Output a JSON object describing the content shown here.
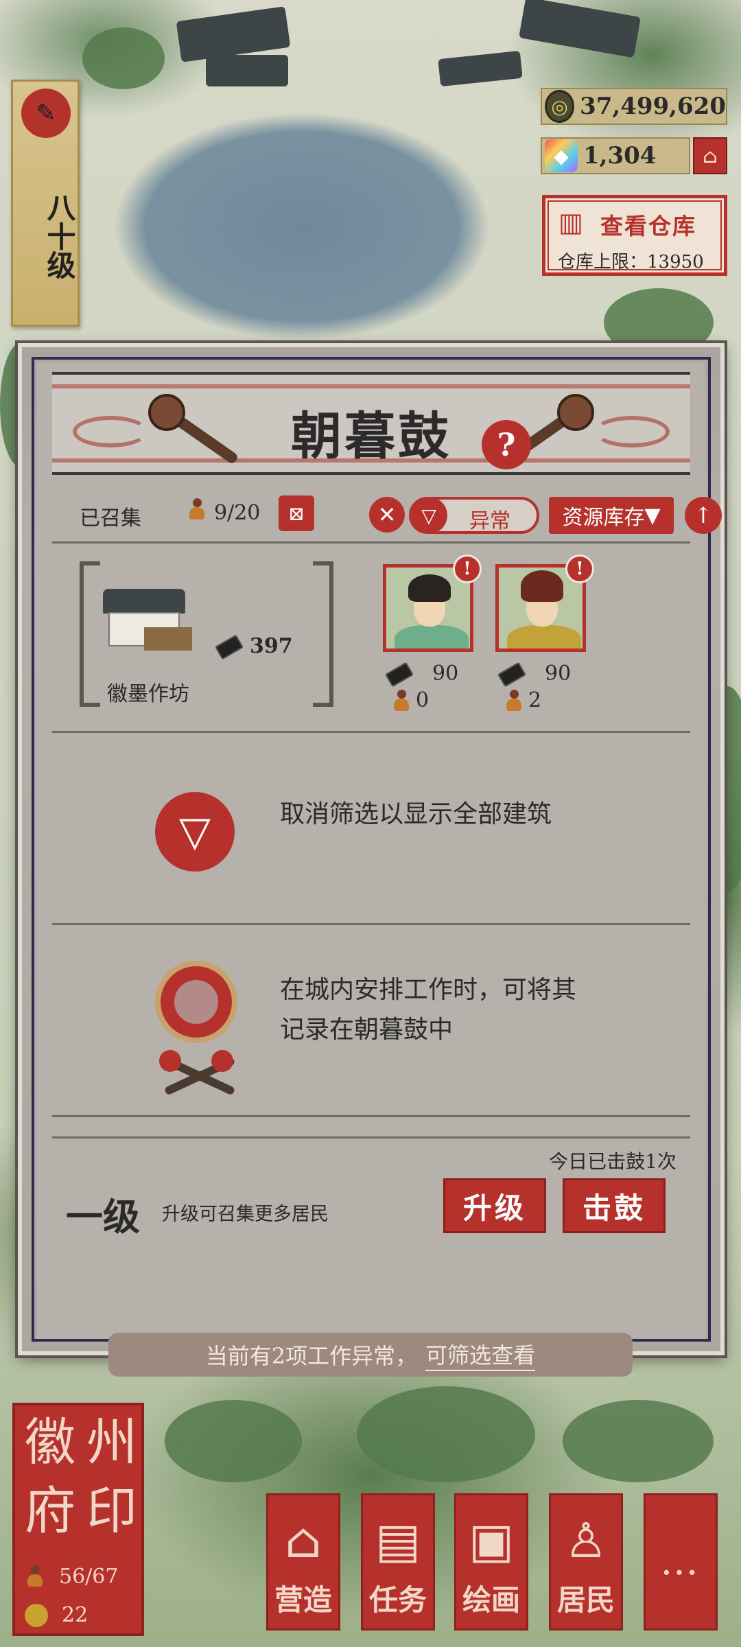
{
  "level_banner": {
    "text": "八十级",
    "icon": "brush-icon"
  },
  "currency": {
    "coins": "37,499,620",
    "gems": "1,304"
  },
  "warehouse": {
    "title": "查看仓库",
    "limit_label": "仓库上限：13950"
  },
  "dialog": {
    "title": "朝暮鼓",
    "help": "?",
    "collected_label": "已召集",
    "collected_count": "9/20",
    "filter_label": "异常",
    "sort_label": "资源库存",
    "building": {
      "name": "徽墨作坊",
      "stock": "397"
    },
    "workers": [
      {
        "ink": "90",
        "residents": "0",
        "alert": "!"
      },
      {
        "ink": "90",
        "residents": "2",
        "alert": "!"
      }
    ],
    "info_filter": "取消筛选以显示全部建筑",
    "info_drum_line1": "在城内安排工作时，可将其",
    "info_drum_line2": "记录在朝暮鼓中",
    "drums_today": "今日已击鼓1次",
    "level_name": "一级",
    "level_hint": "升级可召集更多居民",
    "upgrade_label": "升级",
    "drum_label": "击鼓"
  },
  "notice": {
    "text": "当前有2项工作异常，",
    "link": "可筛选查看"
  },
  "seal": {
    "chars": [
      "徽",
      "州",
      "府",
      "印"
    ],
    "residents": "56/67",
    "coins": "22"
  },
  "nav": {
    "build": "营造",
    "task": "任务",
    "paint": "绘画",
    "residents": "居民",
    "more": "…"
  },
  "colors": {
    "accent_red": "#b7312c",
    "paper": "#b6b1aa",
    "frame_navy": "#2d2b50"
  }
}
